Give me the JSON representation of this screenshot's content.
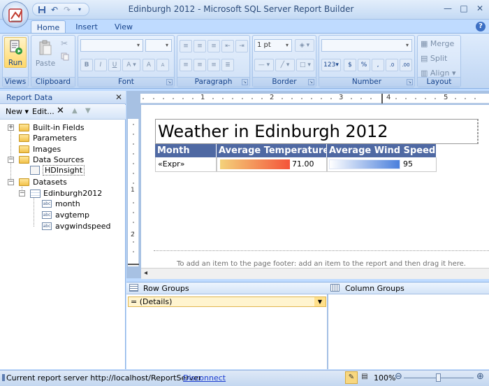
{
  "window": {
    "title": "Edinburgh 2012 - Microsoft SQL Server Report Builder"
  },
  "tabs": [
    {
      "label": "Home"
    },
    {
      "label": "Insert"
    },
    {
      "label": "View"
    }
  ],
  "ribbon": {
    "groups": {
      "views": "Views",
      "clipboard": "Clipboard",
      "font": "Font",
      "paragraph": "Paragraph",
      "border": "Border",
      "number": "Number",
      "layout": "Layout"
    },
    "run_label": "Run",
    "paste_label": "Paste",
    "border_size": "1 pt",
    "merge_label": "Merge",
    "split_label": "Split",
    "align_label": "Align"
  },
  "report_data": {
    "title": "Report Data",
    "toolbar": {
      "new_label": "New",
      "edit_label": "Edit..."
    },
    "tree": [
      {
        "label": "Built-in Fields"
      },
      {
        "label": "Parameters"
      },
      {
        "label": "Images"
      },
      {
        "label": "Data Sources"
      },
      {
        "label": "HDInsight"
      },
      {
        "label": "Datasets"
      },
      {
        "label": "Edinburgh2012"
      },
      {
        "label": "month"
      },
      {
        "label": "avgtemp"
      },
      {
        "label": "avgwindspeed"
      }
    ]
  },
  "ruler": {
    "marks": [
      "1",
      "2",
      "3",
      "4",
      "5"
    ],
    "vmarks": [
      "1",
      "2"
    ]
  },
  "report": {
    "title": "Weather in Edinburgh 2012",
    "columns": [
      "Month",
      "Average Temperature",
      "Average Wind Speed"
    ],
    "row": {
      "month": "«Expr»",
      "temperature": "71.00",
      "wind_speed": "95"
    },
    "footer_hint": "To add an item to the page footer: add an item to the report and then drag it here."
  },
  "groups": {
    "row_groups_label": "Row Groups",
    "column_groups_label": "Column Groups",
    "details_label": "= (Details)"
  },
  "status": {
    "server_text": "Current report server http://localhost/ReportServer",
    "disconnect_label": "Disconnect",
    "zoom": "100%"
  },
  "colors": {
    "accent": "#4f69a3",
    "temp_gradient": [
      "#f4d27a",
      "#f4543a"
    ],
    "wind_gradient": [
      "#ffffff",
      "#4a7fdc"
    ]
  }
}
